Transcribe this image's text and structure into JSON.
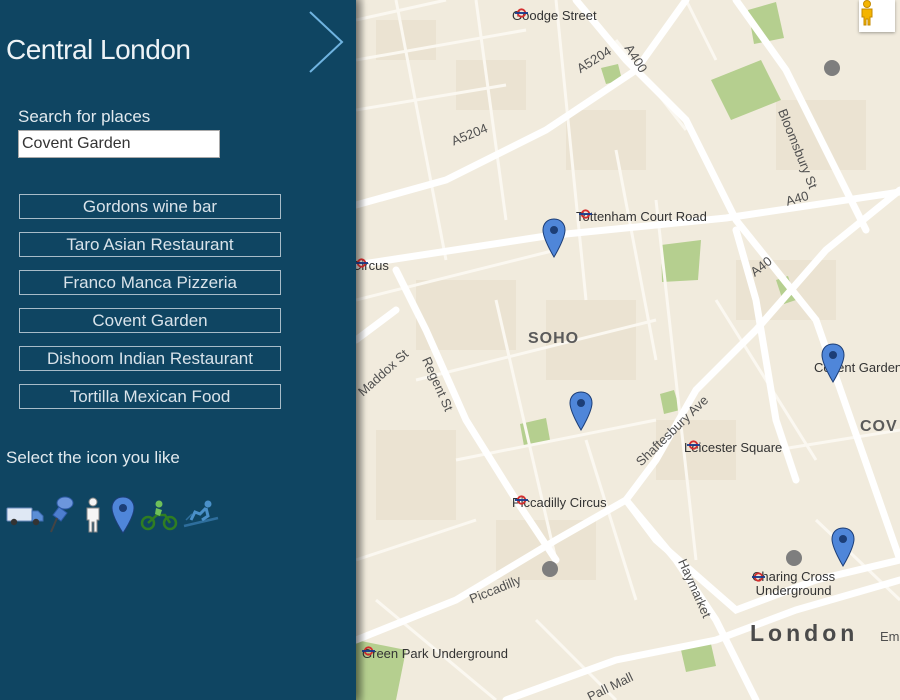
{
  "sidebar": {
    "title": "Central London",
    "search_label": "Search for places",
    "search_value": "Covent Garden",
    "places": [
      "Gordons wine bar",
      "Taro Asian Restaurant",
      "Franco Manca Pizzeria",
      "Covent Garden",
      "Dishoom Indian Restaurant",
      "Tortilla Mexican Food"
    ],
    "icon_prompt": "Select the icon you like",
    "icons": [
      "truck-icon",
      "pushpin-icon",
      "person-icon",
      "map-marker-icon",
      "motorcycle-icon",
      "skier-icon"
    ]
  },
  "map": {
    "areas": {
      "soho": "SOHO",
      "city": "London",
      "covent": "COV"
    },
    "stations": {
      "goodge": "Goodge Street",
      "tottenham": "Tottenham Court Road",
      "oxford": "Circus",
      "covent": "Covent Garden",
      "leicester": "Leicester Square",
      "piccadilly": "Piccadilly Circus",
      "charing_line1": "Charing Cross",
      "charing_line2": "Underground",
      "greenpark": "Green Park Underground"
    },
    "roads": {
      "a5204_a": "A5204",
      "a5204_b": "A5204",
      "a400": "A400",
      "bloomsbury": "Bloomsbury St",
      "a40_a": "A40",
      "a40_b": "A40",
      "maddox": "Maddox St",
      "regent": "Regent St",
      "shaftesbury": "Shaftesbury Ave",
      "haymarket": "Haymarket",
      "piccadilly": "Piccadilly",
      "pallmall": "Pall Mall",
      "em": "Em"
    },
    "colors": {
      "sidebar": "#0f4562",
      "map_bg": "#f1ebdd",
      "park": "#b5cf8f",
      "road": "#ffffff",
      "marker": "#4f86d9",
      "tube": "#d42e2e"
    }
  }
}
